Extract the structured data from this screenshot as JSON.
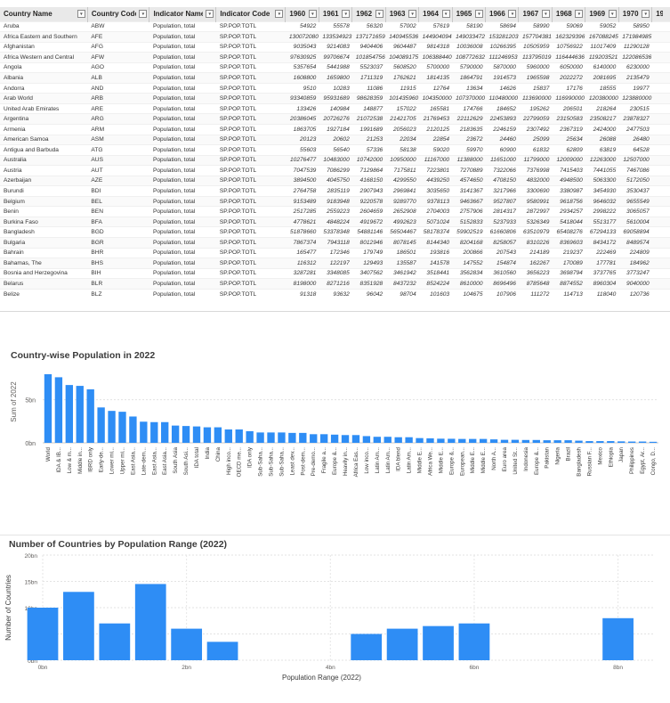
{
  "table": {
    "columns": [
      "Country Name",
      "Country Code",
      "Indicator Name",
      "Indicator Code",
      "1960",
      "1961",
      "1962",
      "1963",
      "1964",
      "1965",
      "1966",
      "1967",
      "1968",
      "1969",
      "1970",
      "19"
    ],
    "filter_glyph": "▾",
    "rows": [
      [
        "Aruba",
        "ABW",
        "Population, total",
        "SP.POP.TOTL",
        "54922",
        "55578",
        "56320",
        "57002",
        "57619",
        "58190",
        "58694",
        "58990",
        "59069",
        "59052",
        "58950"
      ],
      [
        "Africa Eastern and Southern",
        "AFE",
        "Population, total",
        "SP.POP.TOTL",
        "130072080",
        "133534923",
        "137171659",
        "140945536",
        "144904094",
        "149033472",
        "153281203",
        "157704381",
        "162329396",
        "167088245",
        "171984985"
      ],
      [
        "Afghanistan",
        "AFG",
        "Population, total",
        "SP.POP.TOTL",
        "9035043",
        "9214083",
        "9404406",
        "9604487",
        "9814318",
        "10036008",
        "10266395",
        "10505959",
        "10756922",
        "11017409",
        "11290128"
      ],
      [
        "Africa Western and Central",
        "AFW",
        "Population, total",
        "SP.POP.TOTL",
        "97630925",
        "99706674",
        "101854756",
        "104089175",
        "106388440",
        "108772632",
        "111246953",
        "113795019",
        "116444636",
        "119203521",
        "122086536"
      ],
      [
        "Angola",
        "AGO",
        "Population, total",
        "SP.POP.TOTL",
        "5357654",
        "5441988",
        "5523037",
        "5608520",
        "5700000",
        "5790000",
        "5870000",
        "5960000",
        "6050000",
        "6140000",
        "6230000"
      ],
      [
        "Albania",
        "ALB",
        "Population, total",
        "SP.POP.TOTL",
        "1608800",
        "1659800",
        "1711319",
        "1762621",
        "1814135",
        "1864791",
        "1914573",
        "1965598",
        "2022272",
        "2081695",
        "2135479"
      ],
      [
        "Andorra",
        "AND",
        "Population, total",
        "SP.POP.TOTL",
        "9510",
        "10283",
        "11086",
        "11915",
        "12764",
        "13634",
        "14626",
        "15837",
        "17176",
        "18555",
        "19977"
      ],
      [
        "Arab World",
        "ARB",
        "Population, total",
        "SP.POP.TOTL",
        "93340859",
        "95931689",
        "98628359",
        "101435960",
        "104350000",
        "107370000",
        "110480000",
        "113690000",
        "116990000",
        "120380000",
        "123880000"
      ],
      [
        "United Arab Emirates",
        "ARE",
        "Population, total",
        "SP.POP.TOTL",
        "133426",
        "140984",
        "148877",
        "157022",
        "165581",
        "174766",
        "184652",
        "195262",
        "206501",
        "218264",
        "230515"
      ],
      [
        "Argentina",
        "ARG",
        "Population, total",
        "SP.POP.TOTL",
        "20386045",
        "20726276",
        "21072538",
        "21421705",
        "21769453",
        "22112629",
        "22453893",
        "22799059",
        "23150583",
        "23508217",
        "23878327"
      ],
      [
        "Armenia",
        "ARM",
        "Population, total",
        "SP.POP.TOTL",
        "1863705",
        "1927184",
        "1991689",
        "2056023",
        "2120125",
        "2183635",
        "2246159",
        "2307492",
        "2367319",
        "2424000",
        "2477503"
      ],
      [
        "American Samoa",
        "ASM",
        "Population, total",
        "SP.POP.TOTL",
        "20123",
        "20602",
        "21253",
        "22034",
        "22854",
        "23672",
        "24460",
        "25099",
        "25634",
        "26088",
        "26480"
      ],
      [
        "Antigua and Barbuda",
        "ATG",
        "Population, total",
        "SP.POP.TOTL",
        "55603",
        "56540",
        "57336",
        "58138",
        "59020",
        "59970",
        "60900",
        "61832",
        "62809",
        "63819",
        "64528"
      ],
      [
        "Australia",
        "AUS",
        "Population, total",
        "SP.POP.TOTL",
        "10276477",
        "10483000",
        "10742000",
        "10950000",
        "11167000",
        "11388000",
        "11651000",
        "11799000",
        "12009000",
        "12263000",
        "12507000"
      ],
      [
        "Austria",
        "AUT",
        "Population, total",
        "SP.POP.TOTL",
        "7047539",
        "7086299",
        "7129864",
        "7175811",
        "7223801",
        "7270889",
        "7322066",
        "7376998",
        "7415403",
        "7441055",
        "7467086"
      ],
      [
        "Azerbaijan",
        "AZE",
        "Population, total",
        "SP.POP.TOTL",
        "3894500",
        "4045750",
        "4168150",
        "4299550",
        "4439250",
        "4574650",
        "4708150",
        "4832000",
        "4948500",
        "5063300",
        "5172050"
      ],
      [
        "Burundi",
        "BDI",
        "Population, total",
        "SP.POP.TOTL",
        "2764758",
        "2835119",
        "2907943",
        "2969841",
        "3035650",
        "3141367",
        "3217966",
        "3300690",
        "3380987",
        "3454930",
        "3530437"
      ],
      [
        "Belgium",
        "BEL",
        "Population, total",
        "SP.POP.TOTL",
        "9153489",
        "9183948",
        "9220578",
        "9289770",
        "9378113",
        "9463667",
        "9527807",
        "9580991",
        "9618756",
        "9646032",
        "9655549"
      ],
      [
        "Benin",
        "BEN",
        "Population, total",
        "SP.POP.TOTL",
        "2517285",
        "2559223",
        "2604659",
        "2652908",
        "2704003",
        "2757906",
        "2814317",
        "2872997",
        "2934257",
        "2998222",
        "3065057"
      ],
      [
        "Burkina Faso",
        "BFA",
        "Population, total",
        "SP.POP.TOTL",
        "4778621",
        "4848224",
        "4919672",
        "4992623",
        "5071024",
        "5152833",
        "5237933",
        "5326349",
        "5418044",
        "5513177",
        "5610004"
      ],
      [
        "Bangladesh",
        "BGD",
        "Population, total",
        "SP.POP.TOTL",
        "51878660",
        "53378348",
        "54881146",
        "56504467",
        "58178374",
        "59902519",
        "61660806",
        "63510979",
        "65408276",
        "67294133",
        "69058894"
      ],
      [
        "Bulgaria",
        "BGR",
        "Population, total",
        "SP.POP.TOTL",
        "7867374",
        "7943118",
        "8012946",
        "8078145",
        "8144340",
        "8204168",
        "8258057",
        "8310226",
        "8369603",
        "8434172",
        "8489574"
      ],
      [
        "Bahrain",
        "BHR",
        "Population, total",
        "SP.POP.TOTL",
        "165477",
        "172346",
        "179749",
        "186501",
        "193816",
        "200866",
        "207543",
        "214189",
        "219237",
        "222469",
        "224809"
      ],
      [
        "Bahamas, The",
        "BHS",
        "Population, total",
        "SP.POP.TOTL",
        "116312",
        "122197",
        "129493",
        "135587",
        "141578",
        "147552",
        "154874",
        "162267",
        "170089",
        "177781",
        "184962"
      ],
      [
        "Bosnia and Herzegovina",
        "BIH",
        "Population, total",
        "SP.POP.TOTL",
        "3287281",
        "3348085",
        "3407562",
        "3461942",
        "3518441",
        "3562834",
        "3610560",
        "3656223",
        "3698794",
        "3737765",
        "3773247"
      ],
      [
        "Belarus",
        "BLR",
        "Population, total",
        "SP.POP.TOTL",
        "8198000",
        "8271216",
        "8351928",
        "8437232",
        "8524224",
        "8610000",
        "8696496",
        "8785648",
        "8874552",
        "8960304",
        "9040000"
      ],
      [
        "Belize",
        "BLZ",
        "Population, total",
        "SP.POP.TOTL",
        "91318",
        "93632",
        "96042",
        "98704",
        "101603",
        "104675",
        "107906",
        "111272",
        "114713",
        "118040",
        "120736"
      ]
    ]
  },
  "chart1": {
    "title": "Country-wise Population in 2022",
    "color": "#2e8df5",
    "chart_data": {
      "type": "bar",
      "title": "Country-wise Population in 2022",
      "ylabel": "Sum of 2022",
      "xlabel": "",
      "yticks": [
        {
          "value": 0,
          "label": "0bn"
        },
        {
          "value": 5,
          "label": "5bn"
        }
      ],
      "ylim": [
        0,
        9.5
      ],
      "grid": true,
      "categories": [
        "World",
        "IDA & IB...",
        "Low & m...",
        "Middle in...",
        "IBRD only",
        "Early-de...",
        "Lower mi...",
        "Upper mi...",
        "East Asia...",
        "Late-dem...",
        "East Asia...",
        "East Asia...",
        "South Asia",
        "South Asi...",
        "IDA total",
        "India",
        "China",
        "High inco...",
        "OECD me...",
        "IDA only",
        "Sub-Saha...",
        "Sub-Saha...",
        "Sub-Saha...",
        "Least dev...",
        "Post-dem...",
        "Pre-demo...",
        "Fragile a...",
        "Europe &...",
        "Heavily in...",
        "Africa Eas...",
        "Low inco...",
        "Latin Am...",
        "Latin Am...",
        "IDA blend",
        "Latin Am...",
        "Middle E...",
        "Africa We...",
        "Middle E...",
        "Europe &...",
        "European...",
        "Middle E...",
        "Middle E...",
        "North A...",
        "Euro area",
        "United St...",
        "Indonesia",
        "Europe &...",
        "Pakistan",
        "Nigeria",
        "Brazil",
        "Bangladesh",
        "Russian F...",
        "Mexico",
        "Ethiopia",
        "Japan",
        "Philippines",
        "Egypt, Ar...",
        "Congo, D..."
      ],
      "values": [
        7.95,
        7.6,
        6.7,
        6.6,
        6.2,
        4.1,
        3.7,
        3.6,
        3.05,
        2.45,
        2.4,
        2.4,
        2.0,
        1.95,
        1.9,
        1.8,
        1.8,
        1.55,
        1.55,
        1.35,
        1.2,
        1.2,
        1.2,
        1.15,
        1.15,
        1.0,
        1.0,
        0.95,
        0.9,
        0.9,
        0.78,
        0.7,
        0.7,
        0.65,
        0.65,
        0.55,
        0.52,
        0.48,
        0.47,
        0.45,
        0.45,
        0.45,
        0.4,
        0.35,
        0.35,
        0.33,
        0.33,
        0.3,
        0.3,
        0.3,
        0.25,
        0.2,
        0.2,
        0.2,
        0.17,
        0.15,
        0.15,
        0.12
      ]
    }
  },
  "chart2": {
    "title": "Number of Countries by Population Range (2022)",
    "color": "#2e8df5",
    "chart_data": {
      "type": "bar",
      "title": "Number of Countries by Population Range (2022)",
      "xlabel": "Population Range (2022)",
      "ylabel": "Number of Countries",
      "xticks": [
        {
          "value": 0,
          "label": "0bn"
        },
        {
          "value": 2,
          "label": "2bn"
        },
        {
          "value": 4,
          "label": "4bn"
        },
        {
          "value": 6,
          "label": "6bn"
        },
        {
          "value": 8,
          "label": "8bn"
        }
      ],
      "yticks": [
        {
          "value": 0,
          "label": "0bn"
        },
        {
          "value": 5,
          "label": "5bn"
        },
        {
          "value": 10,
          "label": "10bn"
        },
        {
          "value": 15,
          "label": "15bn"
        },
        {
          "value": 20,
          "label": "20bn"
        }
      ],
      "xlim": [
        0,
        8.5
      ],
      "ylim": [
        0,
        20
      ],
      "grid": true,
      "bins": [
        {
          "x": 0.0,
          "count": 10
        },
        {
          "x": 0.5,
          "count": 13
        },
        {
          "x": 1.0,
          "count": 7
        },
        {
          "x": 1.5,
          "count": 14.5
        },
        {
          "x": 2.0,
          "count": 6
        },
        {
          "x": 2.5,
          "count": 3.5
        },
        {
          "x": 4.5,
          "count": 5
        },
        {
          "x": 5.0,
          "count": 6
        },
        {
          "x": 5.5,
          "count": 6.5
        },
        {
          "x": 6.0,
          "count": 7
        },
        {
          "x": 8.0,
          "count": 8
        }
      ]
    }
  }
}
